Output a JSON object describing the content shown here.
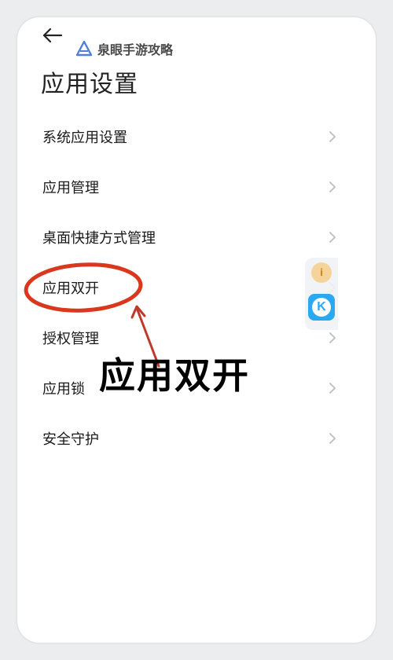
{
  "header": {
    "back_icon": "back-arrow-icon",
    "watermark": "泉眼手游攻略",
    "title": "应用设置"
  },
  "menu": {
    "items": [
      {
        "label": "系统应用设置"
      },
      {
        "label": "应用管理"
      },
      {
        "label": "桌面快捷方式管理"
      },
      {
        "label": "应用双开"
      },
      {
        "label": "授权管理"
      },
      {
        "label": "应用锁"
      },
      {
        "label": "安全守护"
      }
    ]
  },
  "annotation": {
    "callout": "应用双开",
    "highlight_color": "#d9381e"
  },
  "floating_widget": {
    "top_icon": "info-bubble-icon",
    "bottom_icon": "k-app-icon",
    "bottom_letter": "K"
  }
}
